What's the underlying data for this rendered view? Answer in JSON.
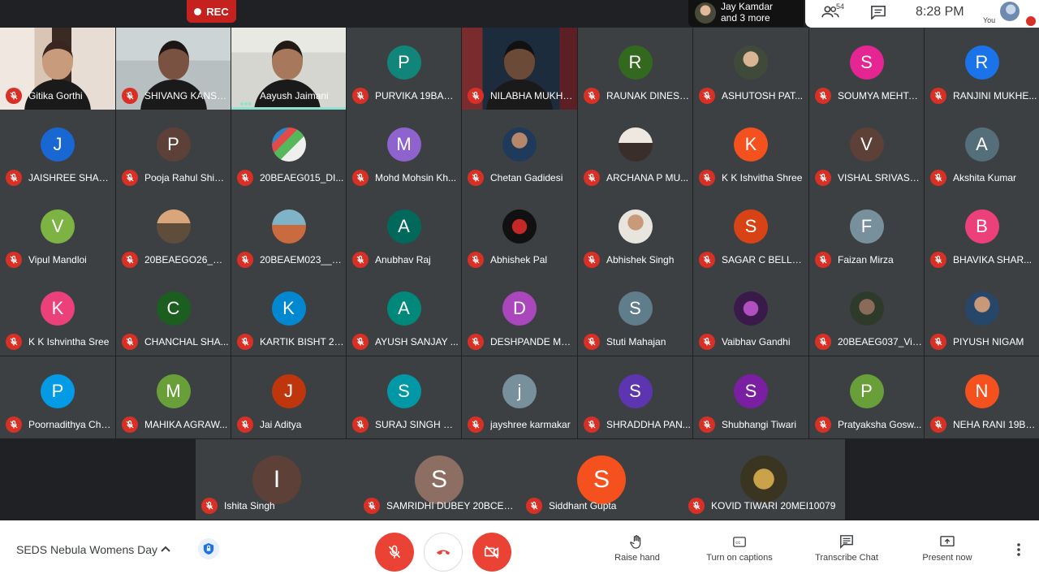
{
  "top": {
    "rec_label": "REC",
    "presenter_name": "Jay Kamdar",
    "presenter_more": "and 3 more",
    "participant_count": "54",
    "clock": "8:28 PM",
    "self_label": "You"
  },
  "tiles": [
    {
      "name": "Gitika Gorthi"
    },
    {
      "name": "SHIVANG KANSA..."
    },
    {
      "name": "Aayush Jaimani"
    },
    {
      "name": "PURVIKA 19BAS1...",
      "letter": "P",
      "color": "#12857a"
    },
    {
      "name": "NILABHA MUKHE..."
    },
    {
      "name": "RAUNAK DINESH...",
      "letter": "R",
      "color": "#33691e"
    },
    {
      "name": "ASHUTOSH PAT..."
    },
    {
      "name": "SOUMYA MEHTA ...",
      "letter": "S",
      "color": "#e52592"
    },
    {
      "name": "RANJINI MUKHE...",
      "letter": "R",
      "color": "#1a73e8"
    },
    {
      "name": "JAISHREE SHAR...",
      "letter": "J",
      "color": "#1967d2"
    },
    {
      "name": "Pooja Rahul Shim...",
      "letter": "P",
      "color": "#5d4037"
    },
    {
      "name": "20BEAEG015_DI..."
    },
    {
      "name": "Mohd Mohsin Kh...",
      "letter": "M",
      "color": "#8e63ce"
    },
    {
      "name": "Chetan Gadidesi"
    },
    {
      "name": "ARCHANA P MU..."
    },
    {
      "name": "K K Ishvitha Shree",
      "letter": "K",
      "color": "#f4511e"
    },
    {
      "name": "VISHAL SRIVAST...",
      "letter": "V",
      "color": "#5d4037"
    },
    {
      "name": "Akshita Kumar",
      "letter": "A",
      "color": "#546e7a"
    },
    {
      "name": "Vipul Mandloi",
      "letter": "V",
      "color": "#7cb342"
    },
    {
      "name": "20BEAEGO26_SA..."
    },
    {
      "name": "20BEAEM023__L..."
    },
    {
      "name": "Anubhav Raj",
      "letter": "A",
      "color": "#00695c"
    },
    {
      "name": "Abhishek Pal"
    },
    {
      "name": "Abhishek Singh"
    },
    {
      "name": "SAGAR C BELLA...",
      "letter": "S",
      "color": "#d84315"
    },
    {
      "name": "Faizan Mirza",
      "letter": "F",
      "color": "#78909c"
    },
    {
      "name": "BHAVIKA SHAR...",
      "letter": "B",
      "color": "#ec407a"
    },
    {
      "name": "K K Ishvintha Sree",
      "letter": "K",
      "color": "#ec407a"
    },
    {
      "name": "CHANCHAL SHA...",
      "letter": "C",
      "color": "#1b5e20"
    },
    {
      "name": "KARTIK BISHT 20...",
      "letter": "K",
      "color": "#0288d1"
    },
    {
      "name": "AYUSH SANJAY ...",
      "letter": "A",
      "color": "#00897b"
    },
    {
      "name": "DESHPANDE ME...",
      "letter": "D",
      "color": "#ab47bc"
    },
    {
      "name": "Stuti Mahajan",
      "letter": "S",
      "color": "#607d8b"
    },
    {
      "name": "Vaibhav Gandhi"
    },
    {
      "name": "20BEAEG037_Viv..."
    },
    {
      "name": "PIYUSH NIGAM"
    },
    {
      "name": "Poornadithya Cha...",
      "letter": "P",
      "color": "#039be5"
    },
    {
      "name": "MAHIKA AGRAW...",
      "letter": "M",
      "color": "#689f38"
    },
    {
      "name": "Jai Aditya",
      "letter": "J",
      "color": "#bf360c"
    },
    {
      "name": "SURAJ SINGH CH...",
      "letter": "S",
      "color": "#0097a7"
    },
    {
      "name": "jayshree karmakar",
      "letter": "j",
      "color": "#78909c"
    },
    {
      "name": "SHRADDHA PAN...",
      "letter": "S",
      "color": "#5e35b1"
    },
    {
      "name": "Shubhangi Tiwari",
      "letter": "S",
      "color": "#7b1fa2"
    },
    {
      "name": "Pratyaksha Gosw...",
      "letter": "P",
      "color": "#689f38"
    },
    {
      "name": "NEHA RANI 19BE...",
      "letter": "N",
      "color": "#f4511e"
    }
  ],
  "bottom_tiles": [
    {
      "name": "Ishita Singh",
      "letter": "I",
      "color": "#5d4037"
    },
    {
      "name": "SAMRIDHI DUBEY 20BCE10...",
      "letter": "S",
      "color": "#8d6e63"
    },
    {
      "name": "Siddhant Gupta",
      "letter": "S",
      "color": "#f4511e"
    },
    {
      "name": "KOVID TIWARI 20MEI10079"
    }
  ],
  "toolbar": {
    "meeting_title": "SEDS Nebula Womens Day",
    "raise_hand": "Raise hand",
    "captions": "Turn on captions",
    "transcribe": "Transcribe Chat",
    "present": "Present now"
  },
  "colors": {
    "accent_red": "#ea4335",
    "tile_bg": "#3c4043",
    "bg": "#202124",
    "speaking": "#8ee2d0"
  }
}
